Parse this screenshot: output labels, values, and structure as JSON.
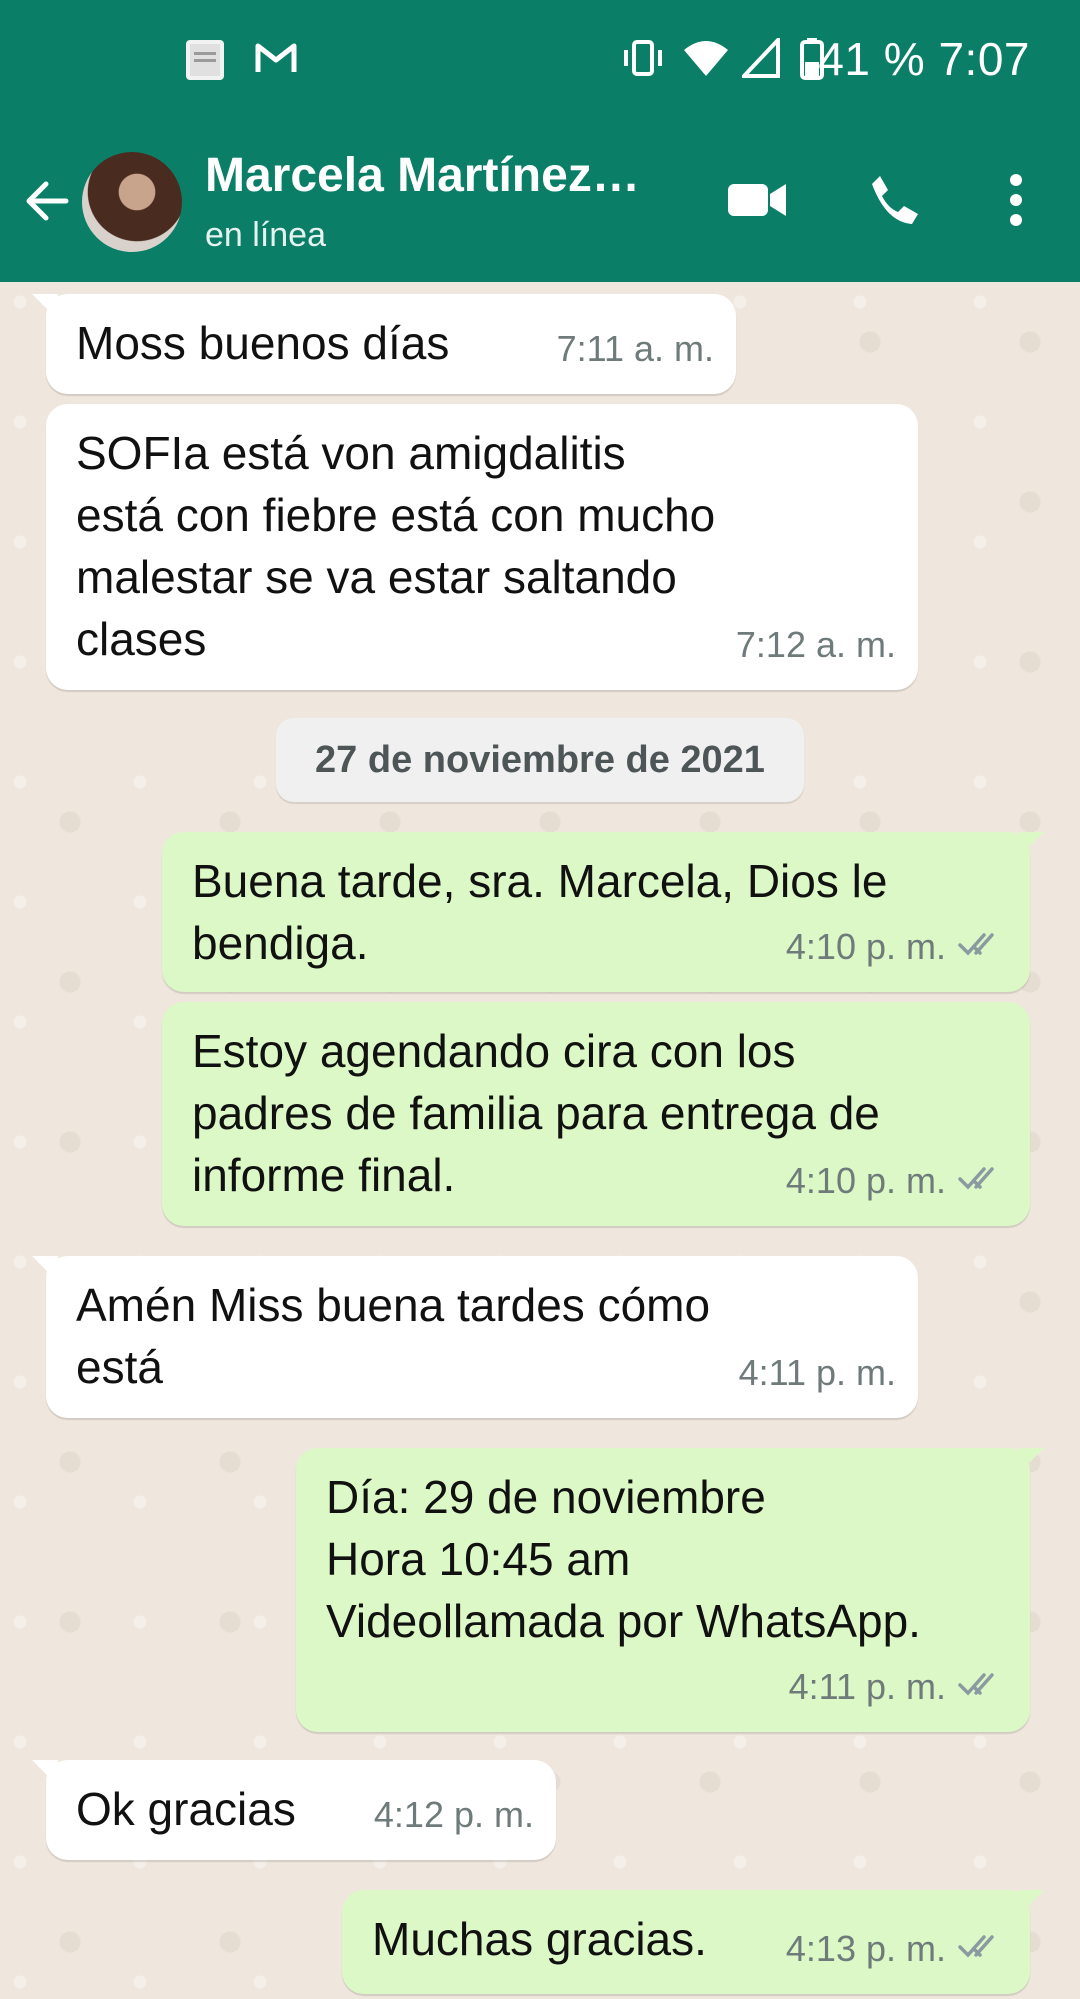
{
  "status_bar": {
    "battery_percent": "41 %",
    "time": "7:07",
    "icons": [
      "holy-bible-app-icon",
      "gmail-icon",
      "vibrate-icon",
      "wifi-icon",
      "signal-icon",
      "battery-icon"
    ]
  },
  "header": {
    "contact_name": "Marcela Martínez…",
    "status": "en línea",
    "icons": [
      "back-arrow-icon",
      "avatar",
      "video-call-icon",
      "phone-call-icon",
      "more-options-icon"
    ]
  },
  "colors": {
    "header_bg": "#0a7e67",
    "chat_bg": "#efe7dd",
    "incoming_bubble": "#ffffff",
    "outgoing_bubble": "#dcf8c6",
    "read_ticks": "#8a9aa0"
  },
  "date_divider": "27 de noviembre de 2021",
  "messages": [
    {
      "direction": "in",
      "text": "Moss buenos días",
      "time": "7:11 a. m."
    },
    {
      "direction": "in",
      "text": "SOFIa está von amigdalitis\nestá con fiebre está con mucho\nmalestar se va estar saltando\nclases",
      "time": "7:12 a. m."
    },
    {
      "direction": "out",
      "text": "Buena tarde, sra. Marcela, Dios le\nbendiga.",
      "time": "4:10 p. m.",
      "status": "read"
    },
    {
      "direction": "out",
      "text": "Estoy agendando cira con los\npadres de familia para entrega de\ninforme final.",
      "time": "4:10 p. m.",
      "status": "read"
    },
    {
      "direction": "in",
      "text": "Amén Miss  buena tardes cómo\nestá",
      "time": "4:11 p. m."
    },
    {
      "direction": "out",
      "text": "Día: 29 de noviembre\nHora 10:45 am\nVideollamada por WhatsApp.",
      "time": "4:11 p. m.",
      "status": "read"
    },
    {
      "direction": "in",
      "text": "Ok gracias",
      "time": "4:12 p. m."
    },
    {
      "direction": "out",
      "text": "Muchas gracias.",
      "time": "4:13 p. m.",
      "status": "read"
    }
  ]
}
